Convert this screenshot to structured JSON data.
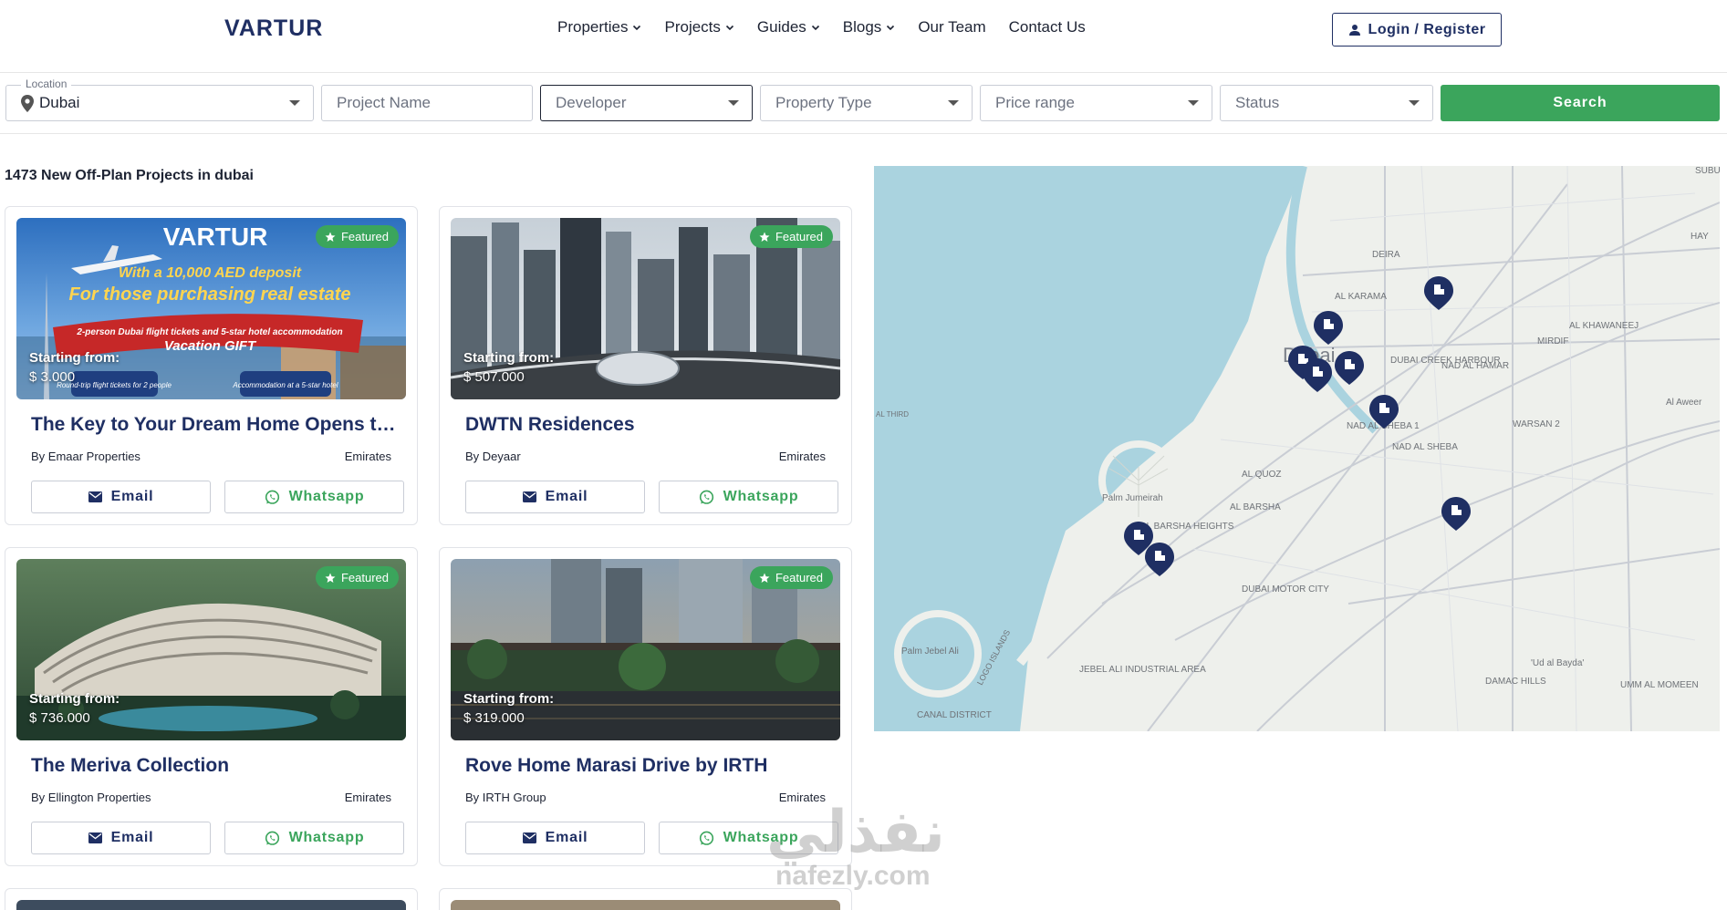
{
  "header": {
    "logo": "VARTUR",
    "nav": [
      {
        "label": "Properties",
        "dropdown": true
      },
      {
        "label": "Projects",
        "dropdown": true
      },
      {
        "label": "Guides",
        "dropdown": true
      },
      {
        "label": "Blogs",
        "dropdown": true
      },
      {
        "label": "Our Team",
        "dropdown": false
      },
      {
        "label": "Contact Us",
        "dropdown": false
      }
    ],
    "login_label": "Login / Register"
  },
  "filters": {
    "location_legend": "Location",
    "location_value": "Dubai",
    "project_name_placeholder": "Project Name",
    "developer_placeholder": "Developer",
    "property_type_placeholder": "Property Type",
    "price_range_placeholder": "Price range",
    "status_placeholder": "Status",
    "search_label": "Search"
  },
  "results": {
    "title": "1473 New Off-Plan Projects in dubai",
    "badge_label": "Featured",
    "price_label": "Starting from:",
    "email_label": "Email",
    "whatsapp_label": "Whatsapp",
    "cards": [
      {
        "title": "The Key to Your Dream Home Opens the Door to Your Dubai Trip!",
        "developer": "By Emaar Properties",
        "location": "Emirates",
        "price": "$ 3.000"
      },
      {
        "title": "DWTN Residences",
        "developer": "By Deyaar",
        "location": "Emirates",
        "price": "$ 507.000"
      },
      {
        "title": "The Meriva Collection",
        "developer": "By Ellington Properties",
        "location": "Emirates",
        "price": "$ 736.000"
      },
      {
        "title": "Rove Home Marasi Drive by IRTH",
        "developer": "By IRTH Group",
        "location": "Emirates",
        "price": "$ 319.000"
      }
    ],
    "promo": {
      "brand": "VARTUR",
      "line1": "With a 10,000 AED deposit",
      "line2": "For those purchasing real estate",
      "line3": "2-person Dubai flight tickets and 5-star hotel accommodation",
      "line4": "Vacation GIFT",
      "tag1": "Round-trip flight tickets for 2 people",
      "tag2": "Accommodation at a 5-star hotel"
    }
  },
  "map": {
    "labels": [
      {
        "text": "DEIRA"
      },
      {
        "text": "AL KARAMA"
      },
      {
        "text": "Dubai"
      },
      {
        "text": "DUBAI CREEK HARBOUR"
      },
      {
        "text": "NAD AL HAMAR"
      },
      {
        "text": "NAD AL SHEBA 1"
      },
      {
        "text": "NAD AL SHEBA"
      },
      {
        "text": "WARSAN 2"
      },
      {
        "text": "Al Aweer"
      },
      {
        "text": "MIRDIF"
      },
      {
        "text": "AL KHAWANEEJ"
      },
      {
        "text": "AL QUOZ"
      },
      {
        "text": "AL BARSHA"
      },
      {
        "text": "Palm Jumeirah"
      },
      {
        "text": "AL BARSHA HEIGHTS"
      },
      {
        "text": "DUBAI MOTOR CITY"
      },
      {
        "text": "Palm Jebel Ali"
      },
      {
        "text": "JEBEL ALI INDUSTRIAL AREA"
      },
      {
        "text": "LOGO ISLANDS"
      },
      {
        "text": "CANAL DISTRICT"
      },
      {
        "text": "DAMAC HILLS"
      },
      {
        "text": "'Ud al Bayda'"
      },
      {
        "text": "UMM AL MOMEEN"
      },
      {
        "text": "AL THIRD"
      },
      {
        "text": "HAY"
      },
      {
        "text": "SUBU"
      }
    ],
    "marker_count": 9
  },
  "watermark": {
    "arabic": "نفذلي",
    "latin": "nafezly.com"
  }
}
